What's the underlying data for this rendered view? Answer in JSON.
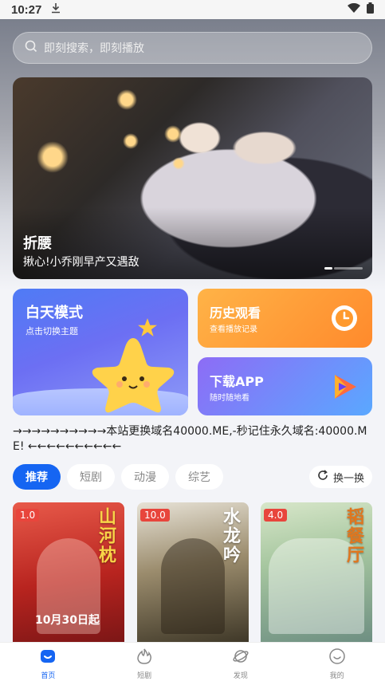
{
  "status_bar": {
    "time": "10:27"
  },
  "search": {
    "placeholder": "即刻搜索，即刻播放"
  },
  "banner": {
    "title": "折腰",
    "subtitle": "揪心!小乔刚早产又遇敌"
  },
  "cards": {
    "day_mode": {
      "title": "白天模式",
      "subtitle": "点击切换主题"
    },
    "history": {
      "title": "历史观看",
      "subtitle": "查看播放记录"
    },
    "download": {
      "title": "下载APP",
      "subtitle": "随时随地看"
    }
  },
  "notice": "→→→→→→→→→→本站更换域名40000.ME,-秒记住永久域名:40000.ME!  ←←←←←←←←←←",
  "tabs": [
    {
      "label": "推荐",
      "active": true
    },
    {
      "label": "短剧",
      "active": false
    },
    {
      "label": "动漫",
      "active": false
    },
    {
      "label": "综艺",
      "active": false
    }
  ],
  "refresh_label": "换一换",
  "posters": [
    {
      "score": "1.0",
      "title": "山河枕",
      "date": "10月30日起"
    },
    {
      "score": "10.0",
      "title": "水龙吟"
    },
    {
      "score": "4.0",
      "title": "韬餐厅"
    }
  ],
  "bottom_nav": [
    {
      "label": "首页",
      "icon": "home-icon",
      "active": true
    },
    {
      "label": "短剧",
      "icon": "flame-icon",
      "active": false
    },
    {
      "label": "发现",
      "icon": "planet-icon",
      "active": false
    },
    {
      "label": "我的",
      "icon": "smile-icon",
      "active": false
    }
  ],
  "colors": {
    "accent": "#1565f2",
    "score_badge": "#e8453c"
  }
}
